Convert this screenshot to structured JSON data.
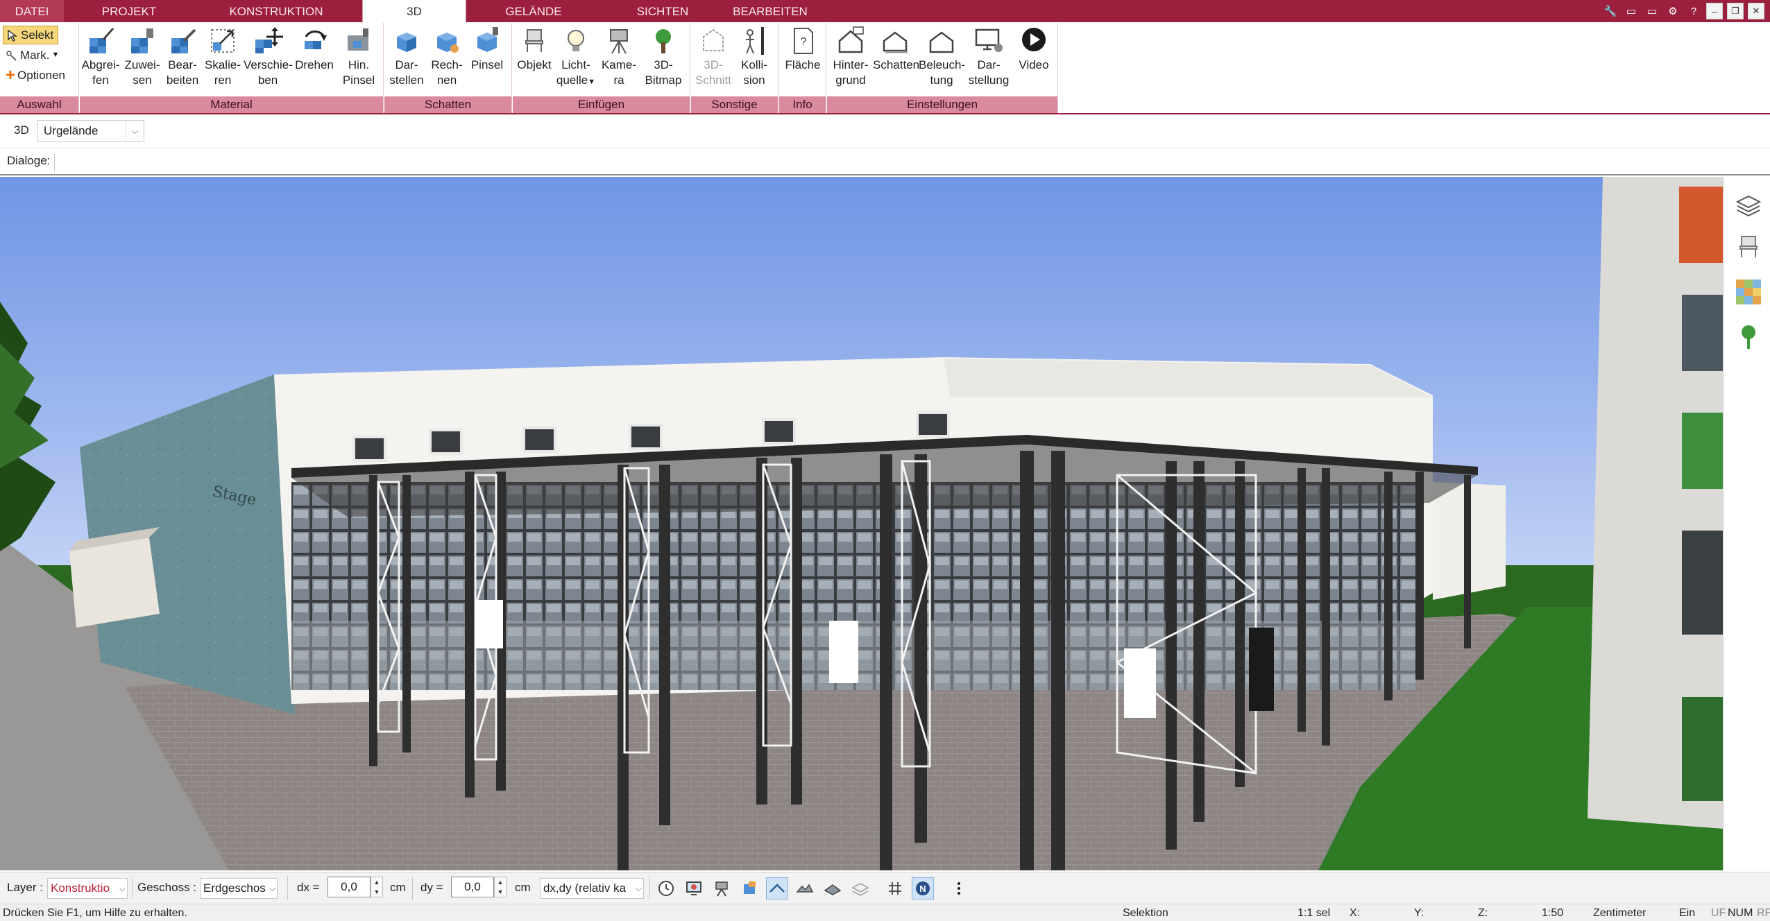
{
  "tabs": [
    "DATEI",
    "PROJEKT",
    "KONSTRUKTION",
    "3D",
    "GELÄNDE",
    "SICHTEN",
    "BEARBEITEN"
  ],
  "active_tab": "3D",
  "ribbon": {
    "auswahl": {
      "label": "Auswahl",
      "selekt": "Selekt",
      "mark": "Mark.",
      "optionen": "Optionen"
    },
    "material": {
      "label": "Material",
      "buttons": [
        {
          "l1": "Abgrei-",
          "l2": "fen"
        },
        {
          "l1": "Zuwei-",
          "l2": "sen"
        },
        {
          "l1": "Bear-",
          "l2": "beiten"
        },
        {
          "l1": "Skalie-",
          "l2": "ren"
        },
        {
          "l1": "Verschie-",
          "l2": "ben"
        },
        {
          "l1": "Drehen",
          "l2": ""
        },
        {
          "l1": "Hin.",
          "l2": "Pinsel"
        }
      ]
    },
    "schatten": {
      "label": "Schatten",
      "buttons": [
        {
          "l1": "Dar-",
          "l2": "stellen"
        },
        {
          "l1": "Rech-",
          "l2": "nen"
        },
        {
          "l1": "Pinsel",
          "l2": ""
        }
      ]
    },
    "einfuegen": {
      "label": "Einfügen",
      "buttons": [
        {
          "l1": "Objekt",
          "l2": ""
        },
        {
          "l1": "Licht-",
          "l2": "quelle"
        },
        {
          "l1": "Kame-",
          "l2": "ra"
        },
        {
          "l1": "3D-",
          "l2": "Bitmap"
        }
      ]
    },
    "sonstige": {
      "label": "Sonstige",
      "buttons": [
        {
          "l1": "3D-",
          "l2": "Schnitt"
        },
        {
          "l1": "Kolli-",
          "l2": "sion"
        }
      ]
    },
    "info": {
      "label": "Info",
      "buttons": [
        {
          "l1": "Fläche",
          "l2": ""
        }
      ]
    },
    "einstellungen": {
      "label": "Einstellungen",
      "buttons": [
        {
          "l1": "Hinter-",
          "l2": "grund"
        },
        {
          "l1": "Schatten",
          "l2": ""
        },
        {
          "l1": "Beleuch-",
          "l2": "tung"
        },
        {
          "l1": "Dar-",
          "l2": "stellung"
        },
        {
          "l1": "Video",
          "l2": ""
        }
      ]
    }
  },
  "view_row": {
    "label": "3D",
    "selected": "Urgelände"
  },
  "dialog_row": {
    "label": "Dialoge:"
  },
  "toolbar": {
    "layer_label": "Layer :",
    "layer_value": "Konstruktio",
    "geschoss_label": "Geschoss :",
    "geschoss_value": "Erdgeschos",
    "dx_label": "dx =",
    "dx_value": "0,0",
    "dx_unit": "cm",
    "dy_label": "dy =",
    "dy_value": "0,0",
    "dy_unit": "cm",
    "mode_value": "dx,dy (relativ ka"
  },
  "status": {
    "help": "Drücken Sie F1, um Hilfe zu erhalten.",
    "mode": "Selektion",
    "sel": "1:1 sel",
    "x": "X:",
    "y": "Y:",
    "z": "Z:",
    "scale": "1:50",
    "unit": "Zentimeter",
    "ein": "Ein",
    "uf": "UF",
    "num": "NUM",
    "rf": "RF"
  },
  "colors": {
    "accent": "#9c1f3d",
    "group_label": "#d98a9d",
    "sky": "#9fb8ef",
    "grass": "#2d6a1e"
  }
}
